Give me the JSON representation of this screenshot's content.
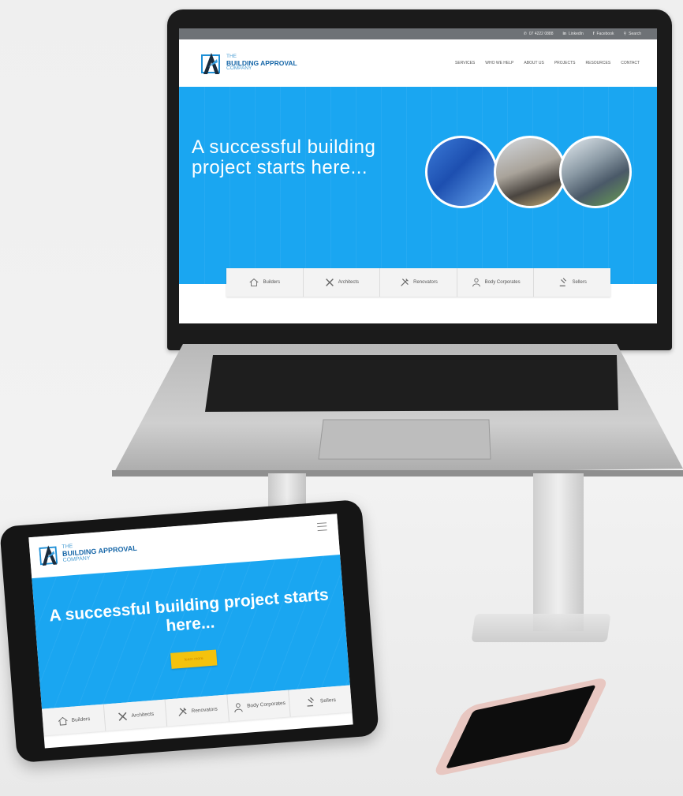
{
  "laptop": {
    "topbar": {
      "phone": "07 4222 0888",
      "linkedin": "LinkedIn",
      "facebook": "Facebook",
      "search": "Search"
    },
    "logo": {
      "line1": "THE",
      "line2": "BUILDING APPROVAL",
      "line3": "COMPANY"
    },
    "nav": [
      "SERVICES",
      "WHO WE HELP",
      "ABOUT US",
      "PROJECTS",
      "RESOURCES",
      "CONTACT"
    ],
    "hero": {
      "title": "A successful building project starts here..."
    },
    "categories": [
      "Builders",
      "Architects",
      "Renovators",
      "Body Corporates",
      "Sellers"
    ]
  },
  "tablet": {
    "logo": {
      "line1": "THE",
      "line2": "BUILDING APPROVAL",
      "line3": "COMPANY"
    },
    "hero": {
      "title": "A successful building project starts here...",
      "button": "learn more"
    },
    "categories": [
      "Builders",
      "Architects",
      "Renovators",
      "Body Corporates",
      "Sellers"
    ]
  },
  "colors": {
    "brand_blue": "#1aa6f1",
    "logo_blue": "#1767a8",
    "button_yellow": "#f4c20d"
  }
}
